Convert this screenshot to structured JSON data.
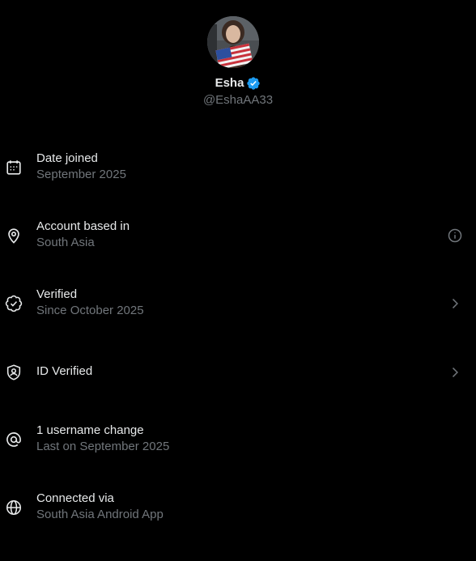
{
  "profile": {
    "name": "Esha",
    "handle": "@EshaAA33",
    "verified_color": "#1d9bf0"
  },
  "rows": [
    {
      "icon": "calendar-icon",
      "title": "Date joined",
      "subtitle": "September 2025",
      "action": null
    },
    {
      "icon": "location-pin-icon",
      "title": "Account based in",
      "subtitle": "South Asia",
      "action": "info-icon"
    },
    {
      "icon": "verified-seal-icon",
      "title": "Verified",
      "subtitle": "Since October 2025",
      "action": "chevron-right-icon"
    },
    {
      "icon": "id-shield-icon",
      "title": "ID Verified",
      "subtitle": "",
      "action": "chevron-right-icon"
    },
    {
      "icon": "at-sign-icon",
      "title": "1 username change",
      "subtitle": "Last on September 2025",
      "action": null
    },
    {
      "icon": "globe-icon",
      "title": "Connected via",
      "subtitle": "South Asia Android App",
      "action": null
    }
  ],
  "colors": {
    "background": "#000000",
    "primary_text": "#e7e9ea",
    "secondary_text": "#71767b"
  }
}
